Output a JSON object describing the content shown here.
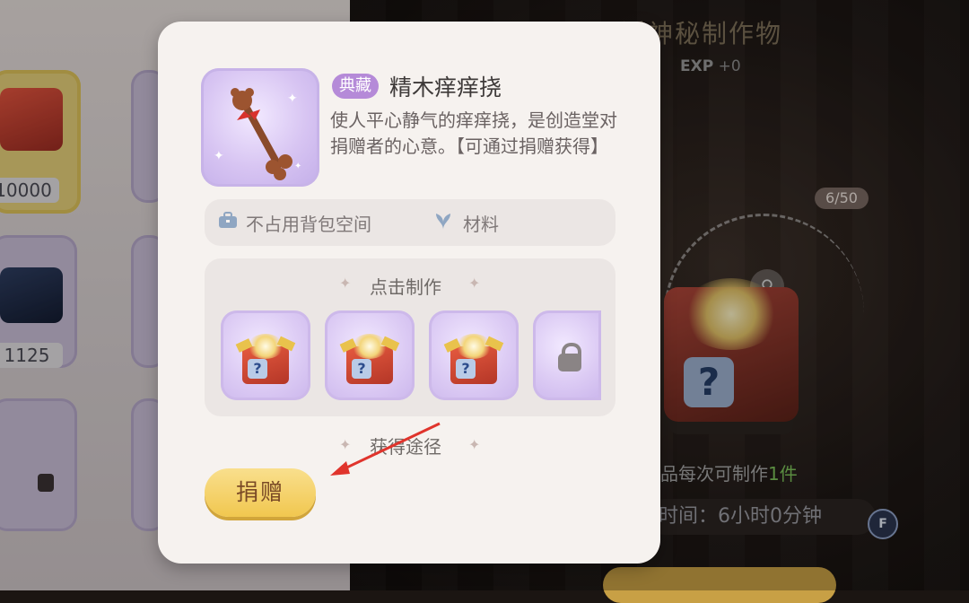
{
  "background": {
    "inventory": {
      "slot_counts": [
        "10000",
        "1125"
      ]
    },
    "right_panel": {
      "title": "潘神秘制作物",
      "exp_label": "EXP",
      "exp_value": "+0",
      "progress": "6/50",
      "per_make_text": "品每次可制作",
      "per_make_count": "1件",
      "time_text": "时间：6小时0分钟",
      "key_hint": "F"
    }
  },
  "item_card": {
    "rarity_badge": "典藏",
    "name": "精木痒痒挠",
    "description": "使人平心静气的痒痒挠，是创造堂对捐赠者的心意。【可通过捐赠获得】",
    "info_bar": {
      "bag_text": "不占用背包空间",
      "type_text": "材料",
      "bag_icon": "toolbox-icon",
      "type_icon": "leaf-icon"
    },
    "craft_section": {
      "title": "点击制作",
      "slots": [
        {
          "icon": "mystery-chest-icon",
          "locked": false
        },
        {
          "icon": "mystery-chest-icon",
          "locked": false
        },
        {
          "icon": "mystery-chest-icon",
          "locked": false
        },
        {
          "icon": "lock-icon",
          "locked": true
        }
      ]
    },
    "obtain_section": {
      "title": "获得途径",
      "donate_button": "捐赠"
    }
  },
  "colors": {
    "card_bg": "#f6f2ef",
    "badge_purple": "#b58ad8",
    "button_yellow": "#f1c74f",
    "arrow_red": "#e0342c"
  }
}
